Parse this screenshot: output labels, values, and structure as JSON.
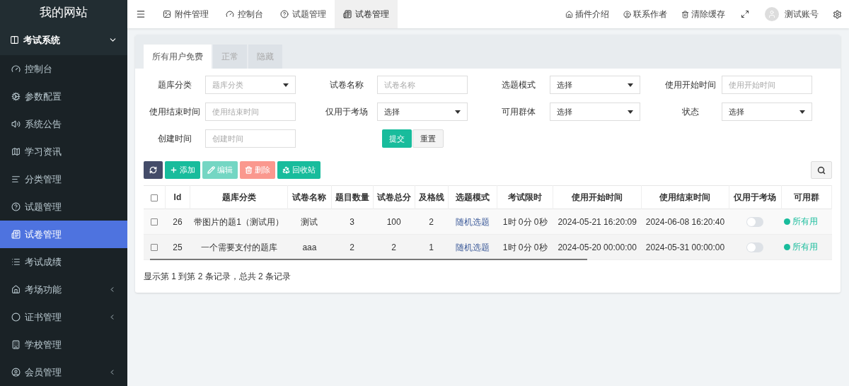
{
  "site_title": "我的网站",
  "sidebar": {
    "group": {
      "label": "考试系统",
      "expanded": true
    },
    "items": [
      {
        "label": "控制台",
        "selected": false,
        "has_submenu": false
      },
      {
        "label": "参数配置",
        "selected": false,
        "has_submenu": false
      },
      {
        "label": "系统公告",
        "selected": false,
        "has_submenu": false
      },
      {
        "label": "学习资讯",
        "selected": false,
        "has_submenu": false
      },
      {
        "label": "分类管理",
        "selected": false,
        "has_submenu": false
      },
      {
        "label": "试题管理",
        "selected": false,
        "has_submenu": false
      },
      {
        "label": "试卷管理",
        "selected": true,
        "has_submenu": false
      },
      {
        "label": "考试成绩",
        "selected": false,
        "has_submenu": false
      },
      {
        "label": "考场功能",
        "selected": false,
        "has_submenu": true
      },
      {
        "label": "证书管理",
        "selected": false,
        "has_submenu": true
      },
      {
        "label": "学校管理",
        "selected": false,
        "has_submenu": false
      },
      {
        "label": "会员管理",
        "selected": false,
        "has_submenu": true
      }
    ]
  },
  "top_tabs": [
    {
      "label": "附件管理",
      "selected": false
    },
    {
      "label": "控制台",
      "selected": false
    },
    {
      "label": "试题管理",
      "selected": false
    },
    {
      "label": "试卷管理",
      "selected": true
    }
  ],
  "top_right": [
    "插件介绍",
    "联系作者",
    "清除缓存"
  ],
  "account": "测试账号",
  "filter_tabs": [
    {
      "label": "所有用户免费",
      "selected": true
    },
    {
      "label": "正常",
      "selected": false
    },
    {
      "label": "隐藏",
      "selected": false
    }
  ],
  "filters": [
    {
      "label": "题库分类",
      "kind": "select",
      "placeholder": "题库分类"
    },
    {
      "label": "试卷名称",
      "kind": "input",
      "placeholder": "试卷名称"
    },
    {
      "label": "选题模式",
      "kind": "select",
      "value": "选择"
    },
    {
      "label": "使用开始时间",
      "kind": "input",
      "placeholder": "使用开始时间"
    },
    {
      "label": "使用结束时间",
      "kind": "input",
      "placeholder": "使用结束时间"
    },
    {
      "label": "仅用于考场",
      "kind": "select",
      "value": "选择"
    },
    {
      "label": "可用群体",
      "kind": "select",
      "value": "选择"
    },
    {
      "label": "状态",
      "kind": "select",
      "value": "选择"
    },
    {
      "label": "创建时间",
      "kind": "input",
      "placeholder": "创建时间"
    }
  ],
  "form_buttons": [
    "提交",
    "重置"
  ],
  "toolbar": [
    {
      "kind": "refresh"
    },
    {
      "kind": "add",
      "label": "添加",
      "disabled": false
    },
    {
      "kind": "edit",
      "label": "编辑",
      "disabled": true
    },
    {
      "kind": "delete",
      "label": "删除",
      "disabled": true
    },
    {
      "kind": "recycle",
      "label": "回收站",
      "disabled": false
    }
  ],
  "table": {
    "select_all_checked": false,
    "columns": [
      "Id",
      "题库分类",
      "试卷名称",
      "题目数量",
      "试卷总分",
      "及格线",
      "选题模式",
      "考试限时",
      "使用开始时间",
      "使用结束时间",
      "仅用于考场",
      "可用群"
    ],
    "rows": [
      {
        "checked": false,
        "id": "26",
        "category": "带图片的题1（测试用）",
        "name": "测试",
        "count": "3",
        "total": "100",
        "pass": "2",
        "mode": "随机选题",
        "limit": "1时 0分 0秒",
        "start": "2024-05-21 16:20:09",
        "end": "2024-06-08 16:20:40",
        "exam_only": false,
        "group": "所有用"
      },
      {
        "checked": false,
        "id": "25",
        "category": "一个需要支付的题库",
        "name": "aaa",
        "count": "2",
        "total": "2",
        "pass": "1",
        "mode": "随机选题",
        "limit": "1时 0分 0秒",
        "start": "2024-05-20 00:00:00",
        "end": "2024-05-31 00:00:00",
        "exam_only": false,
        "group": "所有用"
      }
    ]
  },
  "pagination_info": "显示第 1 到第 2 条记录，总共 2 条记录"
}
